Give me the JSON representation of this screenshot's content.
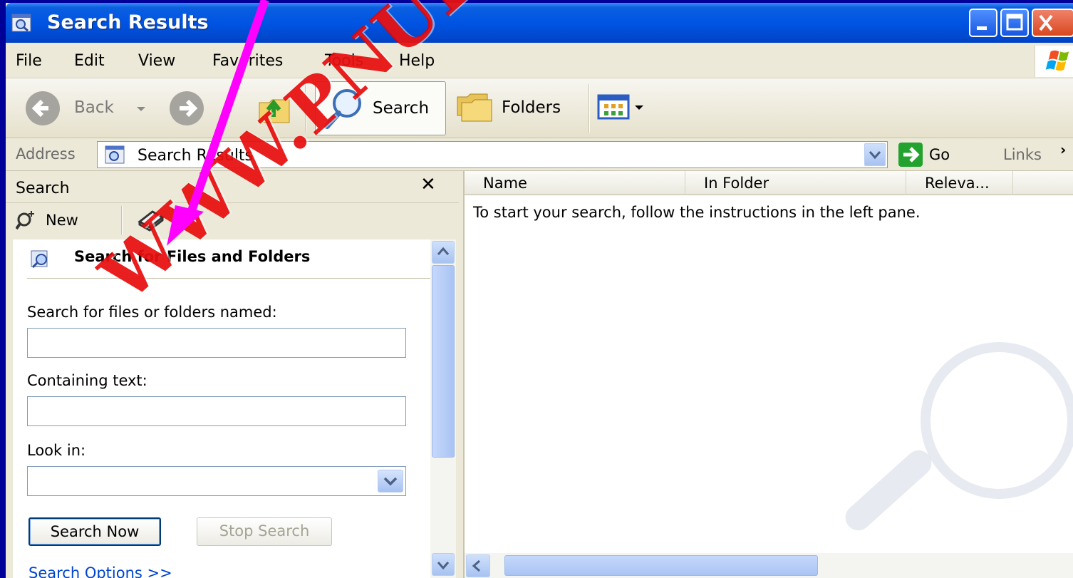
{
  "window": {
    "title": "Search Results"
  },
  "menu": [
    "File",
    "Edit",
    "View",
    "Favorites",
    "Tools",
    "Help"
  ],
  "toolbar": {
    "back_label": "Back",
    "search_label": "Search",
    "folders_label": "Folders"
  },
  "address": {
    "label": "Address",
    "value": "Search Results",
    "go_label": "Go",
    "links_label": "Links"
  },
  "search_pane": {
    "title": "Search",
    "new_label": "New",
    "assistant_title": "Search for Files and Folders",
    "named_label": "Search for files or folders named:",
    "named_value": "",
    "containing_label": "Containing text:",
    "containing_value": "",
    "look_in_label": "Look in:",
    "look_in_value": "",
    "search_now_label": "Search Now",
    "stop_search_label": "Stop Search",
    "options_label": "Search Options >>"
  },
  "results": {
    "columns": [
      "Name",
      "In Folder",
      "Releva..."
    ],
    "hint": "To start your search, follow the instructions in the left pane."
  },
  "watermark": {
    "text": "WWW.PNUEB.COM",
    "color": "#e60000"
  },
  "annotation": {
    "arrow_color": "#ff00ff"
  },
  "icons": [
    "window-search-icon",
    "minimize-icon",
    "maximize-icon",
    "close-icon",
    "windows-flag-icon",
    "back-arrow-icon",
    "forward-arrow-icon",
    "up-folder-icon",
    "search-magnifier-icon",
    "folders-icon",
    "views-icon",
    "go-arrow-icon",
    "new-search-icon",
    "book-icon"
  ],
  "colors": {
    "desktop": "#000099",
    "titlebar": "#0054e3",
    "link": "#0044cc"
  }
}
